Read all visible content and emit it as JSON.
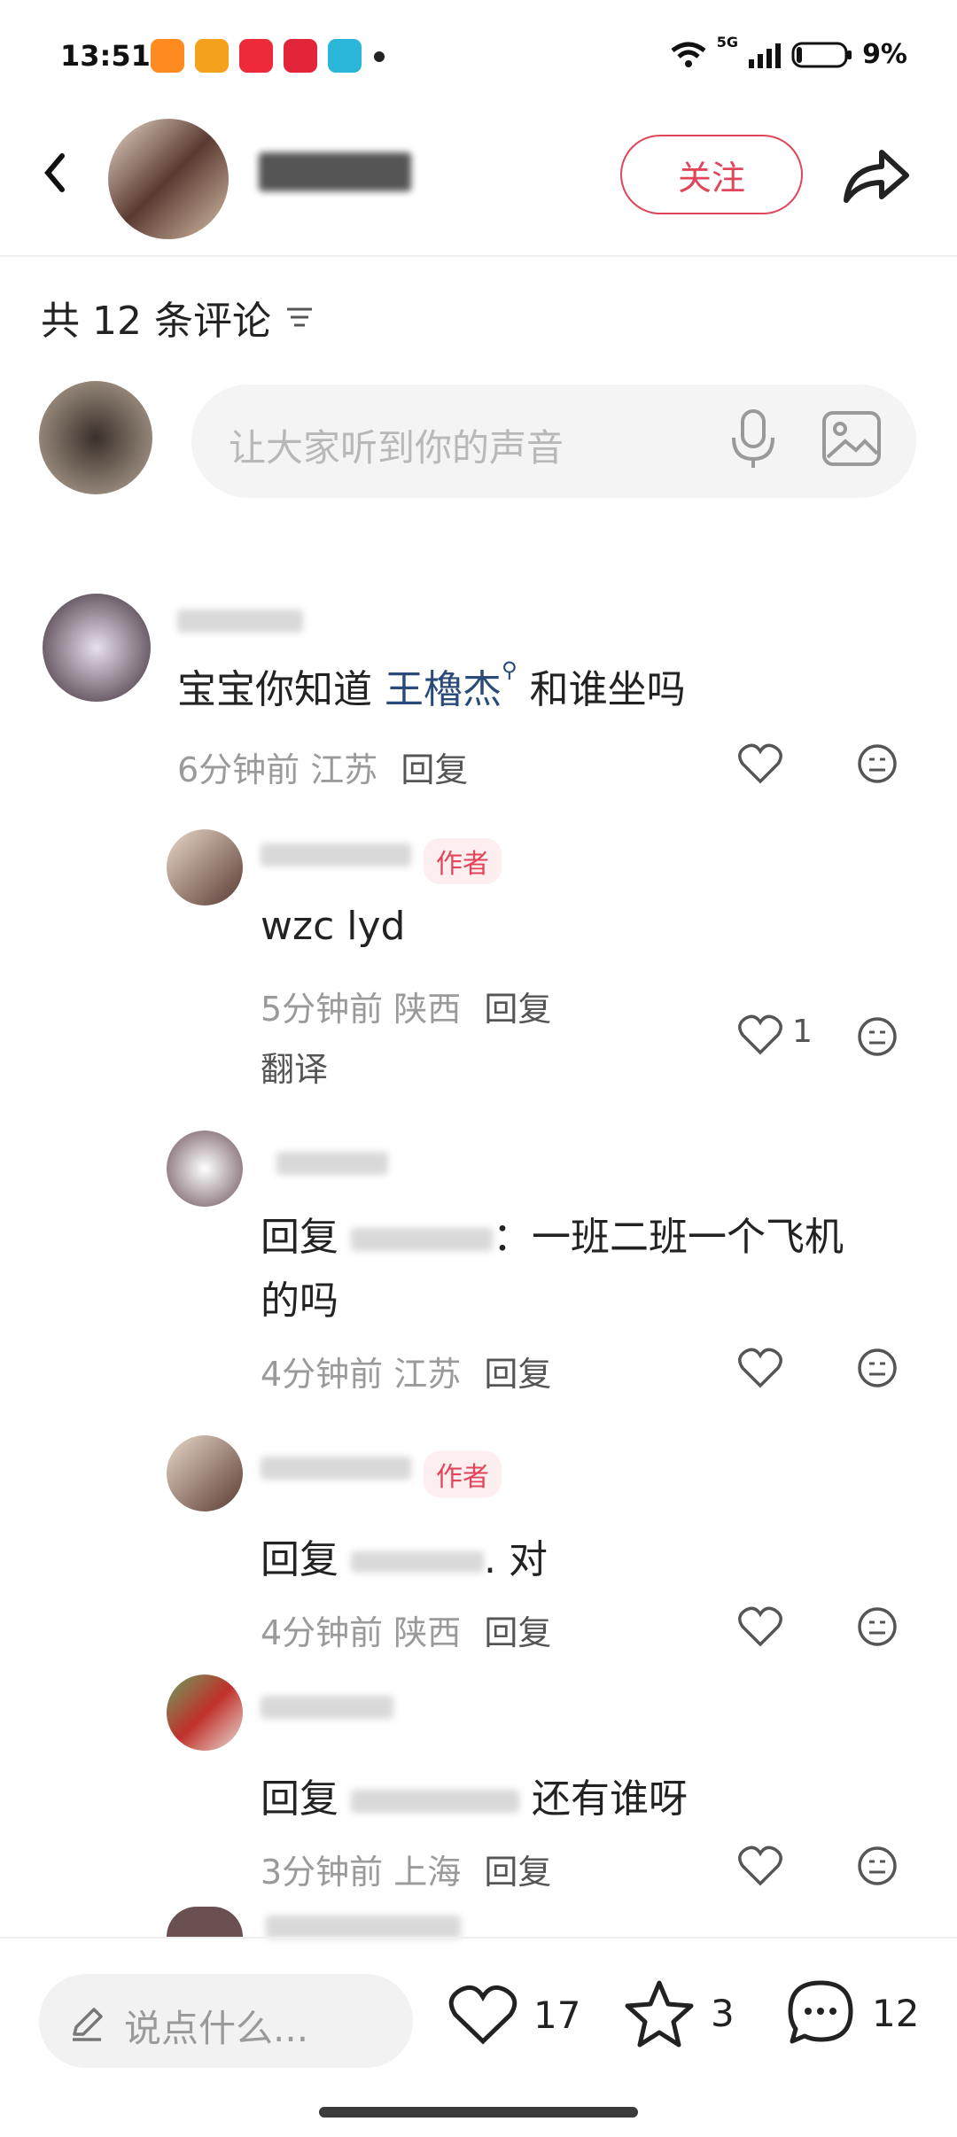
{
  "status_bar": {
    "time": "13:51",
    "network": "5G",
    "battery": "9%",
    "app_icon_colors": [
      "#ff8a1f",
      "#f4a11e",
      "#ee2a3a",
      "#e3253a",
      "#29b6d8"
    ]
  },
  "header": {
    "follow_label": "关注"
  },
  "comments_section": {
    "count_title": "共 12 条评论",
    "input_placeholder": "让大家听到你的声音"
  },
  "comments": [
    {
      "text_prefix": "宝宝你知道 ",
      "mention": "王櫓杰",
      "text_suffix": " 和谁坐吗",
      "time": "6分钟前",
      "location": "江苏",
      "reply_label": "回复"
    },
    {
      "author_tag": "作者",
      "text": "wzc lyd",
      "time": "5分钟前",
      "location": "陕西",
      "reply_label": "回复",
      "translate_label": "翻译",
      "like_count": "1"
    },
    {
      "text_prefix": "回复",
      "text_line1_suffix": "：一班二班一个飞机",
      "text_line2": "的吗",
      "time": "4分钟前",
      "location": "江苏",
      "reply_label": "回复"
    },
    {
      "author_tag": "作者",
      "text_prefix": "回复",
      "text_suffix": ". 对",
      "time": "4分钟前",
      "location": "陕西",
      "reply_label": "回复"
    },
    {
      "text_prefix": "回复",
      "text_suffix": "还有谁呀",
      "time": "3分钟前",
      "location": "上海",
      "reply_label": "回复"
    }
  ],
  "bottom_bar": {
    "say_placeholder": "说点什么...",
    "like_count": "17",
    "star_count": "3",
    "comment_count": "12"
  },
  "colors": {
    "accent": "#e0455a",
    "mention": "#2a4a7a",
    "meta": "#9a9a9a"
  }
}
